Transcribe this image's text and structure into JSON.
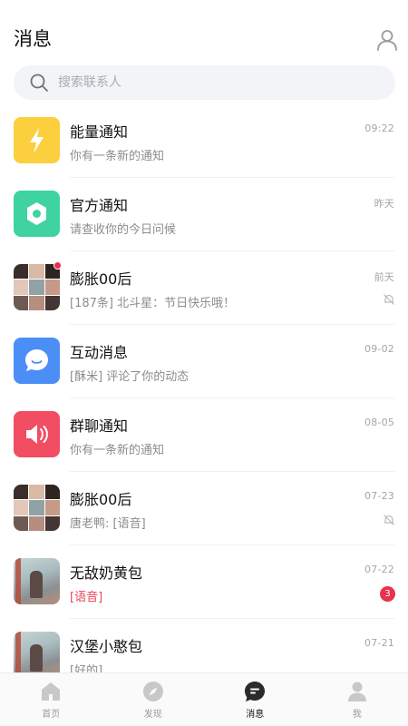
{
  "header": {
    "title": "消息"
  },
  "search": {
    "placeholder": "搜索联系人"
  },
  "conversations": [
    {
      "name": "能量通知",
      "preview": "你有一条新的通知",
      "time": "09:22",
      "avatar": "lightning-icon",
      "color": "#fbcf3d"
    },
    {
      "name": "官方通知",
      "preview": "请查收你的今日问候",
      "time": "昨天",
      "avatar": "hexagon-icon",
      "color": "#3ed3a0"
    },
    {
      "name": "膨胀00后",
      "preview": "[187条] 北斗星：节日快乐哦！",
      "time": "前天",
      "avatar": "group-collage",
      "muted": true,
      "red_dot": true
    },
    {
      "name": "互动消息",
      "preview": "[酥米] 评论了你的动态",
      "time": "09-02",
      "avatar": "chat-bubble-icon",
      "color": "#4b8ef6"
    },
    {
      "name": "群聊通知",
      "preview": "你有一条新的通知",
      "time": "08-05",
      "avatar": "speaker-icon",
      "color": "#f14d63"
    },
    {
      "name": "膨胀00后",
      "preview": "唐老鸭: [语音]",
      "time": "07-23",
      "avatar": "group-collage",
      "muted": true
    },
    {
      "name": "无敌奶黄包",
      "preview": "[语音]",
      "time": "07-22",
      "avatar": "user-photo",
      "badge": "3",
      "preview_color": "#e8455a"
    },
    {
      "name": "汉堡小憨包",
      "preview": "[好的]",
      "time": "07-21",
      "avatar": "user-photo"
    }
  ],
  "tabbar": {
    "items": [
      {
        "label": "首页",
        "icon": "home-icon",
        "active": false
      },
      {
        "label": "发现",
        "icon": "compass-icon",
        "active": false
      },
      {
        "label": "消息",
        "icon": "message-icon",
        "active": true
      },
      {
        "label": "我",
        "icon": "person-icon",
        "active": false
      }
    ]
  },
  "colors": {
    "accent_red": "#e8334d",
    "text_secondary": "#8c8c8c"
  }
}
